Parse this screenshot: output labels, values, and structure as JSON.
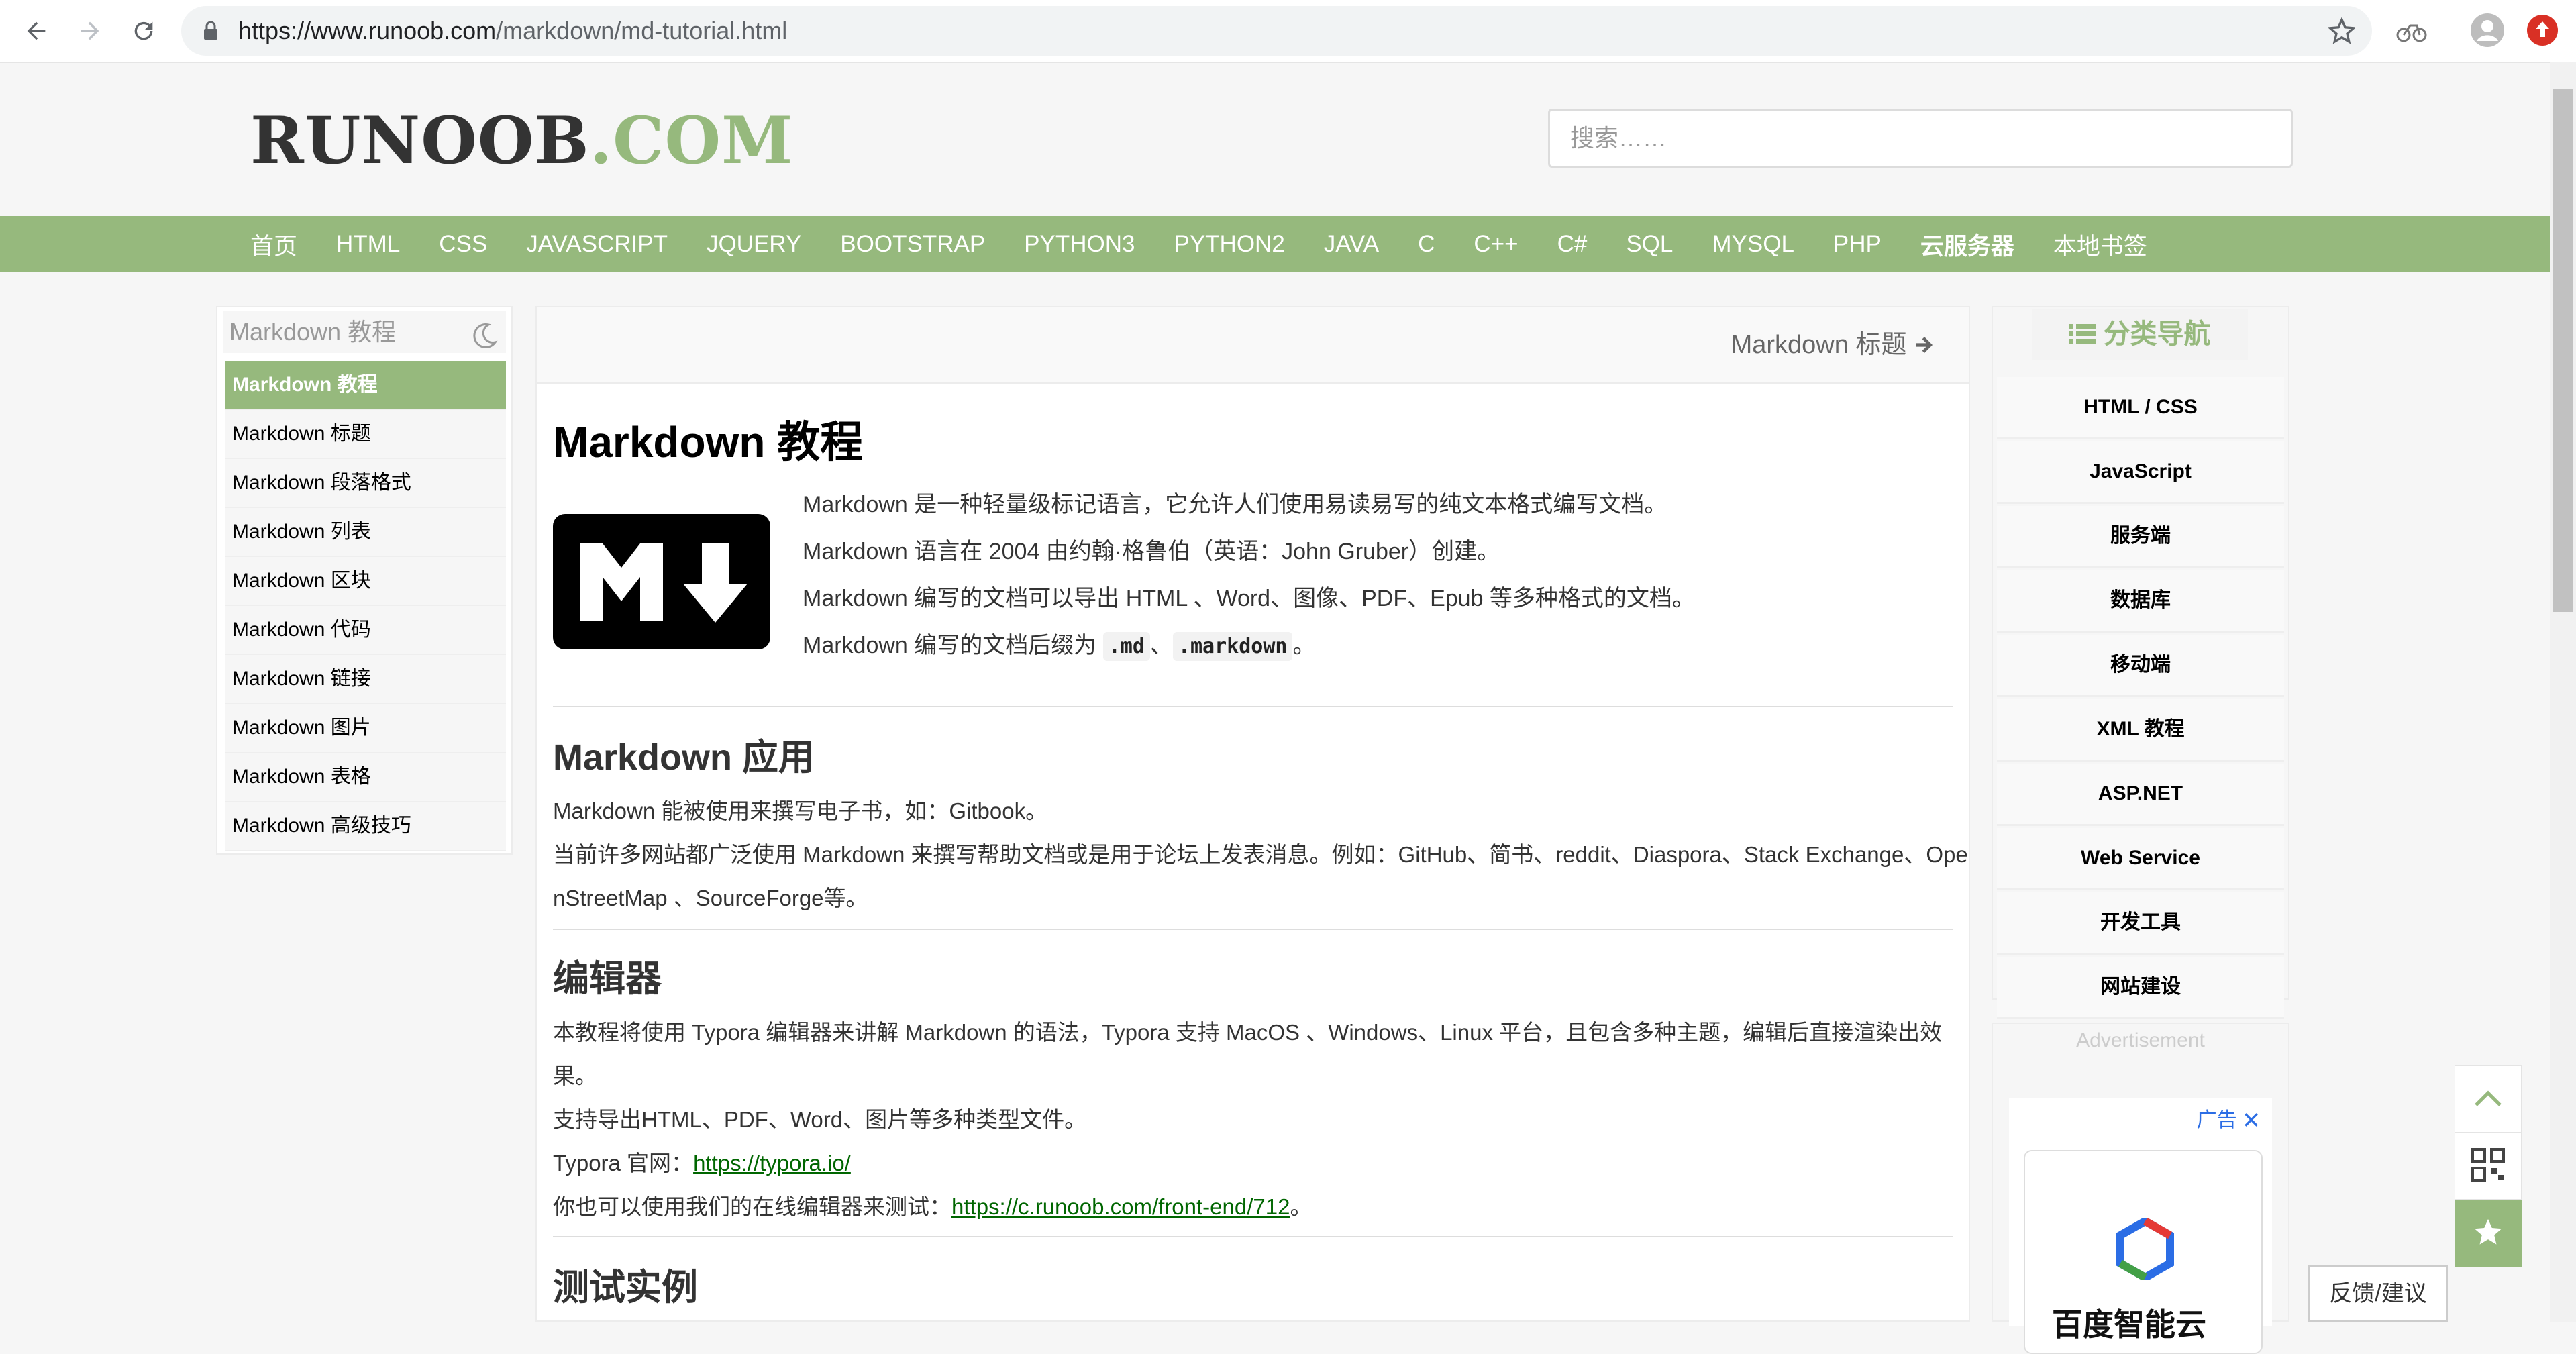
{
  "browser": {
    "url_host": "https://www.runoob.com",
    "url_path": "/markdown/md-tutorial.html"
  },
  "header": {
    "logo_main": "RUNOOB",
    "logo_suffix": ".COM",
    "search_placeholder": "搜索……"
  },
  "nav": [
    "首页",
    "HTML",
    "CSS",
    "JAVASCRIPT",
    "JQUERY",
    "BOOTSTRAP",
    "PYTHON3",
    "PYTHON2",
    "JAVA",
    "C",
    "C++",
    "C#",
    "SQL",
    "MYSQL",
    "PHP",
    "云服务器",
    "本地书签"
  ],
  "left_sidebar": {
    "title": "Markdown 教程",
    "items": [
      "Markdown 教程",
      "Markdown 标题",
      "Markdown 段落格式",
      "Markdown 列表",
      "Markdown 区块",
      "Markdown 代码",
      "Markdown 链接",
      "Markdown 图片",
      "Markdown 表格",
      "Markdown 高级技巧"
    ],
    "active_index": 0
  },
  "main": {
    "next_link": "Markdown 标题",
    "title": "Markdown 教程",
    "intro": [
      "Markdown 是一种轻量级标记语言，它允许人们使用易读易写的纯文本格式编写文档。",
      "Markdown 语言在 2004 由约翰·格鲁伯（英语：John Gruber）创建。",
      "Markdown 编写的文档可以导出 HTML 、Word、图像、PDF、Epub 等多种格式的文档。"
    ],
    "suffix_text": "Markdown 编写的文档后缀为 ",
    "suffix_code1": ".md",
    "suffix_sep": "、",
    "suffix_code2": ".markdown",
    "suffix_end": "。",
    "section1": {
      "title": "Markdown 应用",
      "lines": [
        "Markdown 能被使用来撰写电子书，如：Gitbook。",
        "当前许多网站都广泛使用 Markdown 来撰写帮助文档或是用于论坛上发表消息。例如：GitHub、简书、reddit、Diaspora、Stack Exchange、Ope",
        "nStreetMap 、SourceForge等。"
      ]
    },
    "section2": {
      "title": "编辑器",
      "lines": [
        "本教程将使用 Typora 编辑器来讲解 Markdown 的语法，Typora 支持 MacOS 、Windows、Linux 平台，且包含多种主题，编辑后直接渲染出效",
        "果。",
        "支持导出HTML、PDF、Word、图片等多种类型文件。"
      ],
      "site_label": "Typora 官网：",
      "site_link": "https://typora.io/",
      "online_label": "你也可以使用我们的在线编辑器来测试：",
      "online_link": "https://c.runoob.com/front-end/712",
      "online_end": "。"
    },
    "section3": {
      "title": "测试实例"
    }
  },
  "right_sidebar": {
    "title": "分类导航",
    "items": [
      "HTML / CSS",
      "JavaScript",
      "服务端",
      "数据库",
      "移动端",
      "XML 教程",
      "ASP.NET",
      "Web Service",
      "开发工具",
      "网站建设"
    ],
    "ad_label": "Advertisement",
    "ad_tag": "广告",
    "ad_brand": "百度智能云"
  },
  "feedback": "反馈/建议",
  "colors": {
    "brand_green": "#96b97d",
    "link_green": "#006600"
  }
}
